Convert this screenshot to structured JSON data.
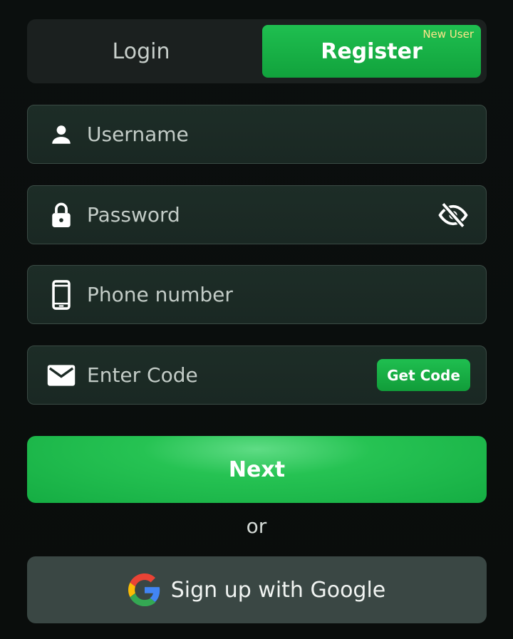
{
  "tabs": {
    "login_label": "Login",
    "register_label": "Register",
    "register_badge": "New User"
  },
  "fields": {
    "username_placeholder": "Username",
    "password_placeholder": "Password",
    "phone_placeholder": "Phone number",
    "code_placeholder": "Enter Code"
  },
  "buttons": {
    "get_code_label": "Get Code",
    "next_label": "Next",
    "google_label": "Sign up with Google"
  },
  "divider_text": "or",
  "icons": {
    "username": "user-icon",
    "password": "lock-icon",
    "password_toggle": "eye-off-icon",
    "phone": "phone-icon",
    "code": "mail-icon",
    "google": "google-icon"
  },
  "colors": {
    "accent": "#1fbf50",
    "badge": "#ffe58a"
  }
}
